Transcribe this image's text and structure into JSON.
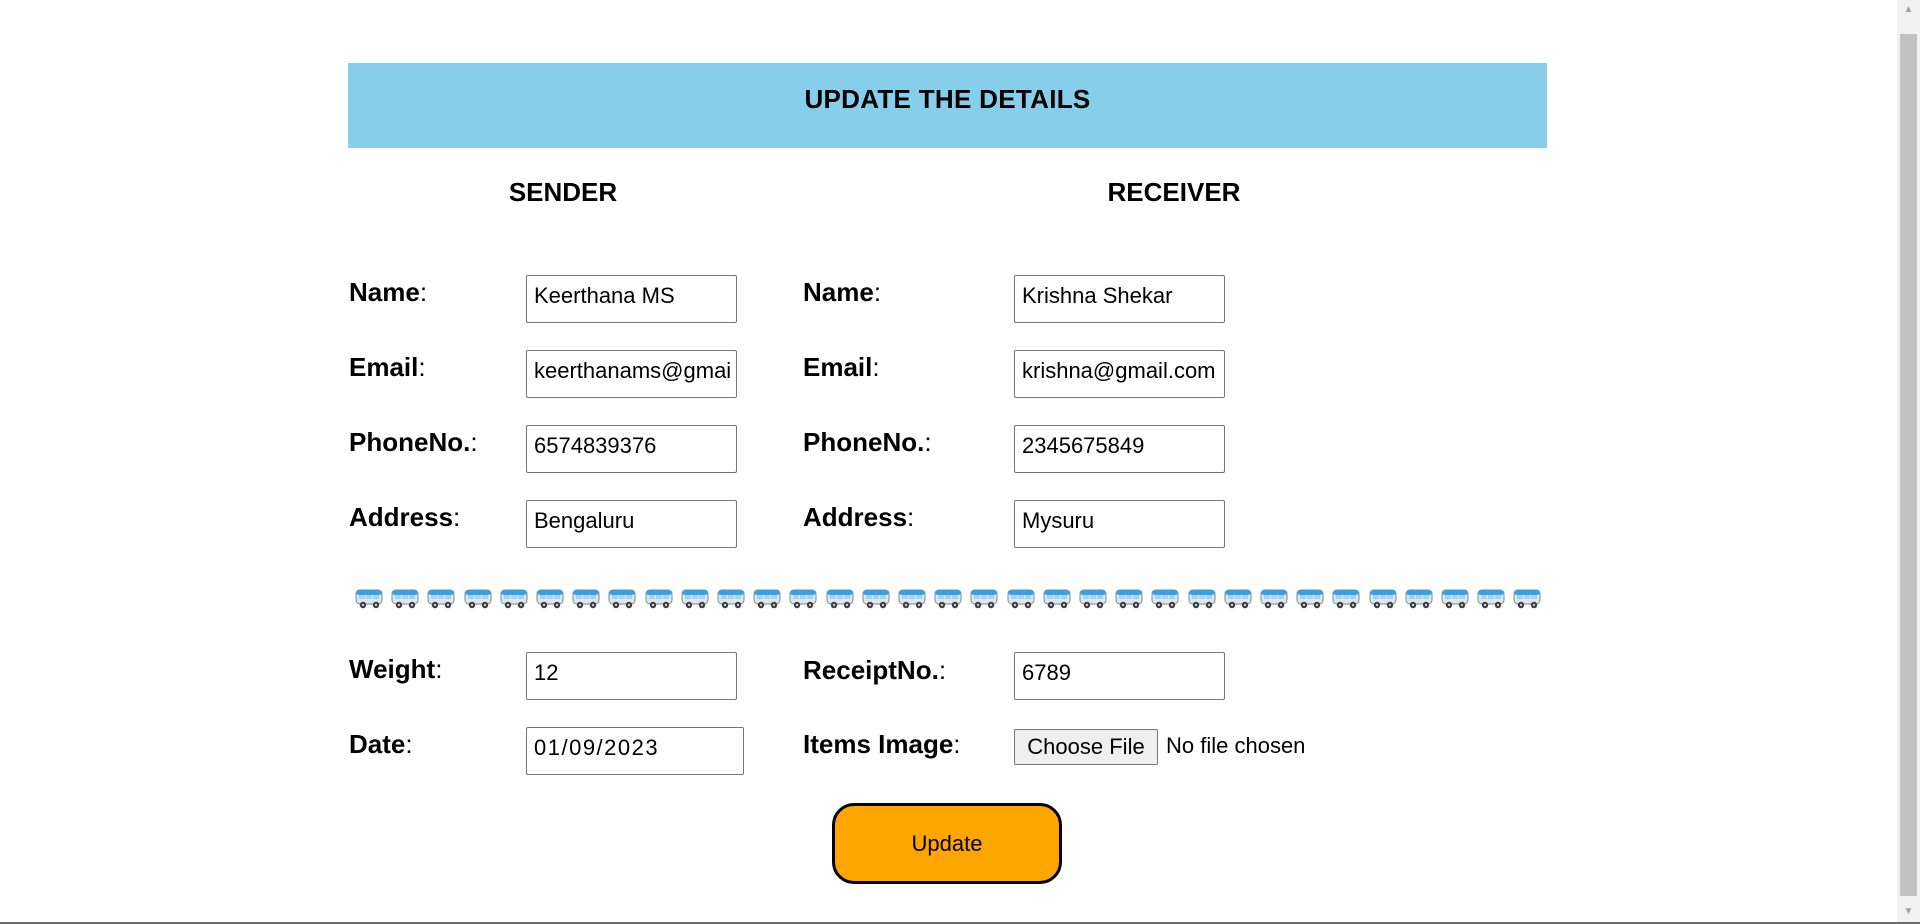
{
  "header": {
    "title": "UPDATE THE DETAILS"
  },
  "sender": {
    "heading": "SENDER",
    "name_label": "Name",
    "name_value": "Keerthana MS",
    "email_label": "Email",
    "email_value": "keerthanams@gmail.com",
    "phone_label": "PhoneNo.",
    "phone_value": "6574839376",
    "address_label": "Address",
    "address_value": "Bengaluru"
  },
  "receiver": {
    "heading": "RECEIVER",
    "name_label": "Name",
    "name_value": "Krishna Shekar",
    "email_label": "Email",
    "email_value": "krishna@gmail.com",
    "phone_label": "PhoneNo.",
    "phone_value": "2345675849",
    "address_label": "Address",
    "address_value": "Mysuru"
  },
  "colon": ":",
  "divider": {
    "icon": "bus-icon",
    "count": 33
  },
  "package": {
    "weight_label": "Weight",
    "weight_value": "12",
    "receipt_label": "ReceiptNo.",
    "receipt_value": "6789",
    "date_label": "Date",
    "date_value": "01/09/2023",
    "image_label": "Items Image",
    "choose_file_label": "Choose File",
    "file_status": "No file chosen"
  },
  "actions": {
    "update_label": "Update"
  },
  "colors": {
    "header_bg": "#87ceeb",
    "button_bg": "#ffa500"
  }
}
